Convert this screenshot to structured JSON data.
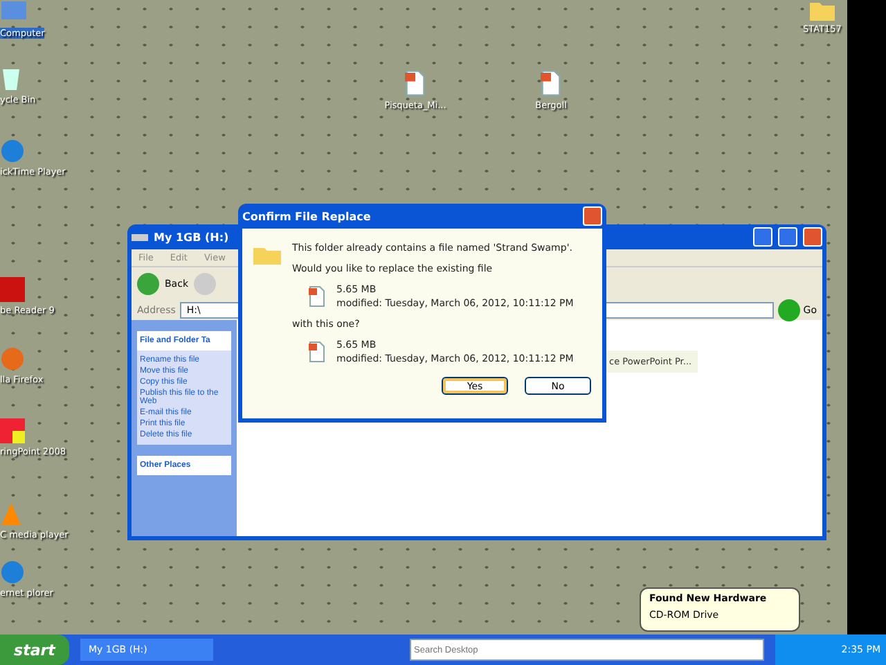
{
  "desktop_icons": [
    {
      "label": "Computer",
      "kind": "computer",
      "selected": true
    },
    {
      "label": "ycle Bin",
      "kind": "bin",
      "selected": false
    },
    {
      "label": "ickTime Player",
      "kind": "player",
      "selected": false
    },
    {
      "label": "be Reader 9",
      "kind": "reader",
      "selected": false
    },
    {
      "label": "lla Firefox",
      "kind": "browser",
      "selected": false
    },
    {
      "label": "ringPoint 2008",
      "kind": "app",
      "selected": false
    },
    {
      "label": "C media player",
      "kind": "cone",
      "selected": false
    },
    {
      "label": "ernet plorer",
      "kind": "browser2",
      "selected": false
    }
  ],
  "center_icons": [
    {
      "label": "Pisqueta_Mi...",
      "kind": "doc"
    },
    {
      "label": "Bergoll",
      "kind": "doc"
    },
    {
      "label": "STAT157",
      "kind": "folder"
    }
  ],
  "explorer": {
    "title": "My 1GB (H:)",
    "menu": [
      "File",
      "Edit",
      "View"
    ],
    "back": "Back",
    "address_label": "Address",
    "address": "H:\\",
    "go": "Go",
    "tasks_title": "File and Folder Ta",
    "tasks": [
      "Rename this file",
      "Move this file",
      "Copy this file",
      "Publish this file to the Web",
      "E-mail this file",
      "Print this file",
      "Delete this file"
    ],
    "other_places": "Other Places",
    "file_label": "ce PowerPoint Pr..."
  },
  "dialog": {
    "title": "Confirm File Replace",
    "message": "This folder already contains a file named 'Strand Swamp'.",
    "question": "Would you like to replace the existing file",
    "existing": {
      "size": "5.65 MB",
      "modified": "modified: Tuesday, March 06, 2012, 10:11:12 PM"
    },
    "with_label": "with this one?",
    "replacement": {
      "size": "5.65 MB",
      "modified": "modified: Tuesday, March 06, 2012, 10:11:12 PM"
    },
    "buttons": [
      {
        "label": "Yes",
        "selected": true
      },
      {
        "label": "No",
        "selected": false
      }
    ]
  },
  "balloon": {
    "title": "Found New Hardware",
    "body": "CD-ROM Drive"
  },
  "taskbar": {
    "start": "start",
    "task": "My 1GB (H:)",
    "search_placeholder": "Search Desktop",
    "clock": "2:35 PM"
  }
}
